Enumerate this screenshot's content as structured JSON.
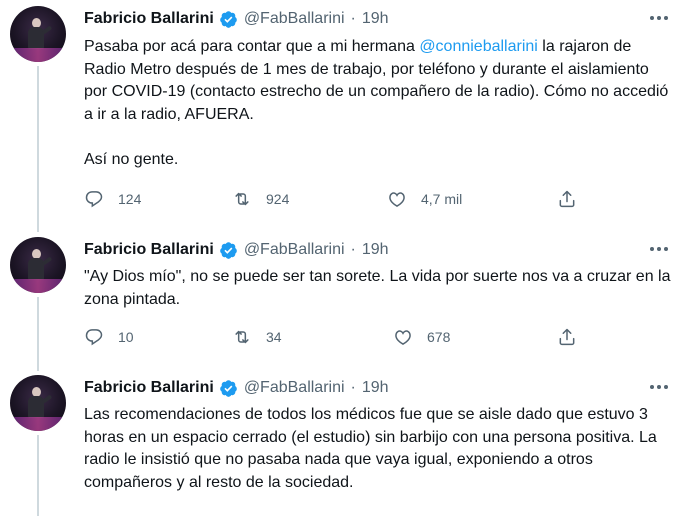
{
  "tweets": [
    {
      "author": "Fabricio Ballarini",
      "handle": "@FabBallarini",
      "dot": "·",
      "time": "19h",
      "text_before_mention": "Pasaba por acá para contar que a mi hermana ",
      "mention": "@connieballarini",
      "text_after_mention": " la rajaron de Radio Metro después de 1 mes de trabajo, por teléfono y durante el aislamiento por COVID-19 (contacto estrecho de un compañero de la radio). Cómo no accedió a ir a la radio, AFUERA.",
      "second_paragraph": "Así no gente.",
      "replies": "124",
      "retweets": "924",
      "likes": "4,7 mil"
    },
    {
      "author": "Fabricio Ballarini",
      "handle": "@FabBallarini",
      "dot": "·",
      "time": "19h",
      "text": "\"Ay Dios mío\", no se puede ser tan sorete. La vida por suerte nos va a cruzar en la zona pintada.",
      "replies": "10",
      "retweets": "34",
      "likes": "678"
    },
    {
      "author": "Fabricio Ballarini",
      "handle": "@FabBallarini",
      "dot": "·",
      "time": "19h",
      "text": "Las recomendaciones de todos los médicos fue que se aisle dado que estuvo 3 horas en un espacio cerrado (el estudio) sin barbijo con una persona positiva. La radio le insistió que no pasaba nada que vaya igual, exponiendo a otros compañeros y al resto de la sociedad."
    }
  ],
  "icons": {
    "verified": "verified-badge-icon",
    "more": "more-options-icon",
    "reply": "reply-icon",
    "retweet": "retweet-icon",
    "like": "like-icon",
    "share": "share-icon"
  },
  "colors": {
    "text": "#0f1419",
    "secondary": "#536471",
    "accent": "#1d9bf0",
    "thread_line": "#cfd9de"
  }
}
